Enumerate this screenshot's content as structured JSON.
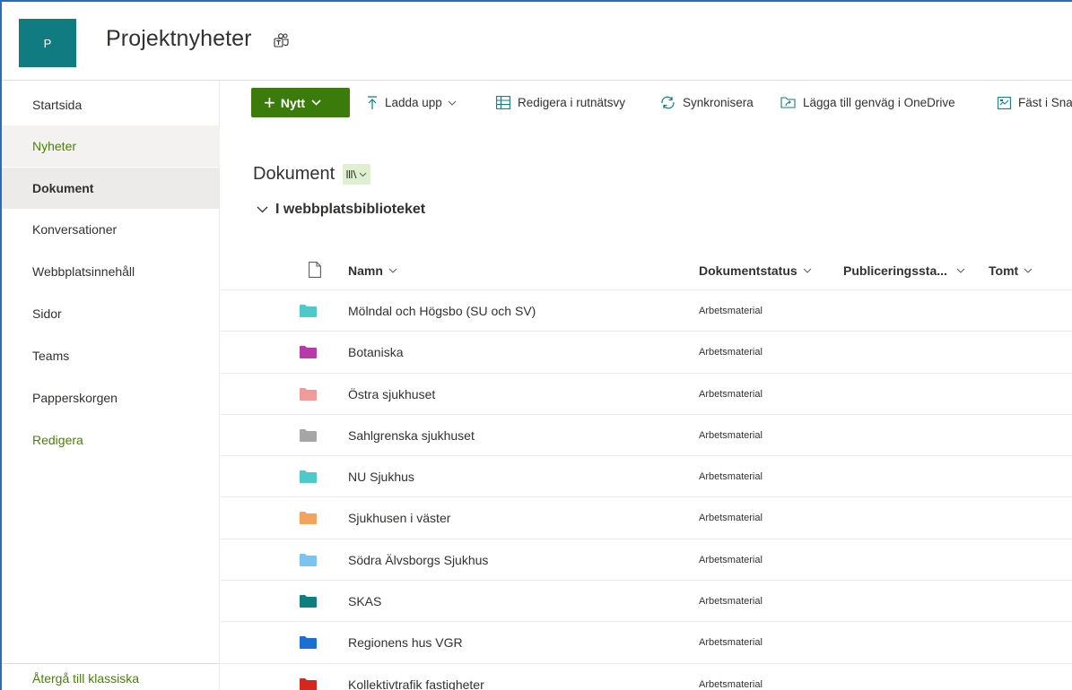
{
  "site": {
    "logo_letter": "P",
    "title": "Projektnyheter",
    "teams_icon": "teams-icon",
    "accent": "#107c81"
  },
  "nav": {
    "items": [
      {
        "label": "Startsida",
        "state": "normal"
      },
      {
        "label": "Nyheter",
        "state": "hover"
      },
      {
        "label": "Dokument",
        "state": "selected"
      },
      {
        "label": "Konversationer",
        "state": "normal"
      },
      {
        "label": "Webbplatsinnehåll",
        "state": "normal"
      },
      {
        "label": "Sidor",
        "state": "normal"
      },
      {
        "label": "Teams",
        "state": "normal"
      },
      {
        "label": "Papperskorgen",
        "state": "normal"
      },
      {
        "label": "Redigera",
        "state": "green"
      }
    ],
    "footer_link": "Återgå till klassiska"
  },
  "commandbar": {
    "new_label": "Nytt",
    "upload_label": "Ladda upp",
    "grid_label": "Redigera i rutnätsvy",
    "sync_label": "Synkronisera",
    "shortcut_label": "Lägga till genväg i OneDrive",
    "pin_label": "Fäst i Sna",
    "accent": "#3b7b0c"
  },
  "library": {
    "title": "Dokument",
    "group_label": "I webbplatsbiblioteket",
    "columns": {
      "name": "Namn",
      "status": "Dokumentstatus",
      "publishing": "Publiceringssta...",
      "empty": "Tomt"
    },
    "rows": [
      {
        "name": "Mölndal och Högsbo (SU och SV)",
        "status": "Arbetsmaterial",
        "folder_color": "#4ec8c8"
      },
      {
        "name": "Botaniska",
        "status": "Arbetsmaterial",
        "folder_color": "#b83aa8"
      },
      {
        "name": "Östra sjukhuset",
        "status": "Arbetsmaterial",
        "folder_color": "#f29a9a"
      },
      {
        "name": "Sahlgrenska sjukhuset",
        "status": "Arbetsmaterial",
        "folder_color": "#a6a6a6"
      },
      {
        "name": "NU Sjukhus",
        "status": "Arbetsmaterial",
        "folder_color": "#4ec8c8"
      },
      {
        "name": "Sjukhusen i väster",
        "status": "Arbetsmaterial",
        "folder_color": "#f5a25d"
      },
      {
        "name": "Södra Älvsborgs Sjukhus",
        "status": "Arbetsmaterial",
        "folder_color": "#7cc3ef"
      },
      {
        "name": "SKAS",
        "status": "Arbetsmaterial",
        "folder_color": "#0f7f7f"
      },
      {
        "name": "Regionens hus VGR",
        "status": "Arbetsmaterial",
        "folder_color": "#1b6fd1"
      },
      {
        "name": "Kollektivtrafik fastigheter",
        "status": "Arbetsmaterial",
        "folder_color": "#d6271e"
      }
    ]
  }
}
